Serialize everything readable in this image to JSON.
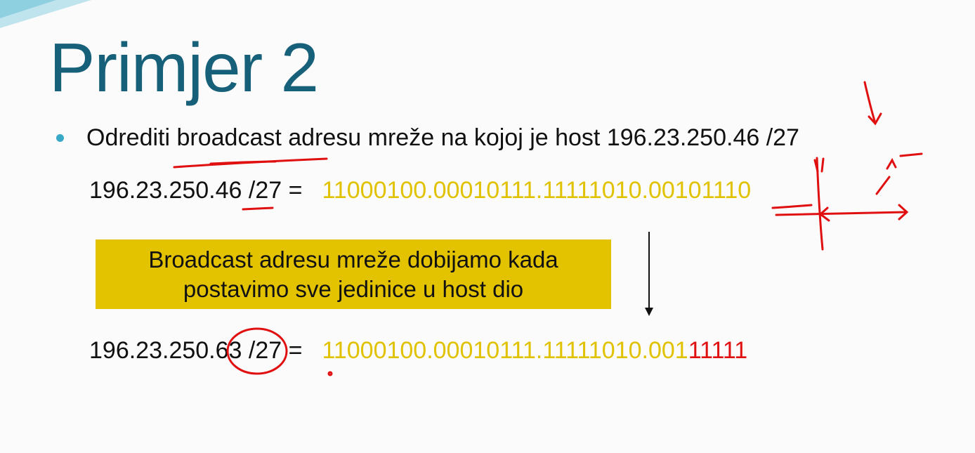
{
  "slide": {
    "title": "Primjer 2",
    "bullet": "Odrediti broadcast adresu mreže na kojoj je host 196.23.250.46 /27",
    "row1": {
      "lhs": "196.23.250.46 /27 =",
      "binary_black_part": "11000100.00010111.11111010.00101110",
      "binary_red_part": ""
    },
    "note_line1": "Broadcast adresu mreže dobijamo kada",
    "note_line2": "postavimo sve jedinice u host dio",
    "row2": {
      "lhs": "196.23.250.63 /27 =",
      "binary_yellow_part": "11000100.00010111.11111010.001",
      "binary_red_part": "11111"
    }
  },
  "colors": {
    "title": "#17607a",
    "bullet": "#39a8c6",
    "binary": "#e0c200",
    "highlight": "#e01010",
    "note_box": "#e3c300",
    "annotation": "#e01010"
  }
}
